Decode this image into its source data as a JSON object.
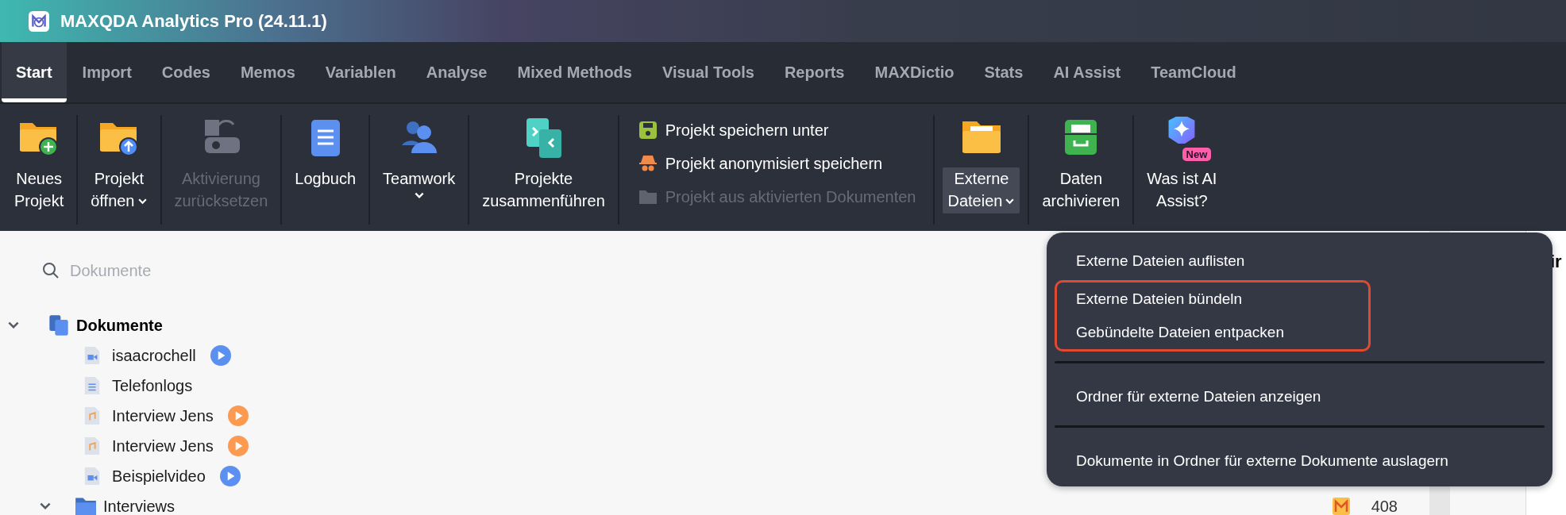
{
  "window": {
    "title": "MAXQDA Analytics Pro (24.11.1)"
  },
  "tabs": [
    {
      "label": "Start",
      "selected": true
    },
    {
      "label": "Import",
      "selected": false
    },
    {
      "label": "Codes",
      "selected": false
    },
    {
      "label": "Memos",
      "selected": false
    },
    {
      "label": "Variablen",
      "selected": false
    },
    {
      "label": "Analyse",
      "selected": false
    },
    {
      "label": "Mixed Methods",
      "selected": false
    },
    {
      "label": "Visual Tools",
      "selected": false
    },
    {
      "label": "Reports",
      "selected": false
    },
    {
      "label": "MAXDictio",
      "selected": false
    },
    {
      "label": "Stats",
      "selected": false
    },
    {
      "label": "AI Assist",
      "selected": false
    },
    {
      "label": "TeamCloud",
      "selected": false
    }
  ],
  "toolbar": [
    {
      "kind": "large",
      "lines": [
        "Neues",
        "Projekt"
      ],
      "dropdown": false,
      "disabled": false,
      "open": false
    },
    {
      "kind": "large",
      "lines": [
        "Projekt",
        "öffnen"
      ],
      "dropdown": true,
      "disabled": false,
      "open": false
    },
    {
      "kind": "large",
      "lines": [
        "Aktivierung",
        "zurücksetzen"
      ],
      "dropdown": false,
      "disabled": true,
      "open": false
    },
    {
      "kind": "large",
      "lines": [
        "Logbuch"
      ],
      "dropdown": false,
      "disabled": false,
      "open": false
    },
    {
      "kind": "large",
      "lines": [
        "Teamwork"
      ],
      "dropdown": true,
      "disabled": false,
      "open": false
    },
    {
      "kind": "large",
      "lines": [
        "Projekte",
        "zusammenführen"
      ],
      "dropdown": false,
      "disabled": false,
      "open": false
    },
    {
      "kind": "stack",
      "items": [
        {
          "label": "Projekt speichern unter",
          "disabled": false
        },
        {
          "label": "Projekt anonymisiert speichern",
          "disabled": false
        },
        {
          "label": "Projekt aus aktivierten Dokumenten",
          "disabled": true
        }
      ]
    },
    {
      "kind": "large",
      "lines": [
        "Externe",
        "Dateien"
      ],
      "dropdown": true,
      "disabled": false,
      "open": true
    },
    {
      "kind": "large",
      "lines": [
        "Daten",
        "archivieren"
      ],
      "dropdown": false,
      "disabled": false,
      "open": false
    },
    {
      "kind": "large",
      "lines": [
        "Was ist AI",
        "Assist?"
      ],
      "dropdown": false,
      "disabled": false,
      "open": false,
      "badge": "New"
    }
  ],
  "search": {
    "placeholder": "Dokumente"
  },
  "tree": [
    {
      "kind": "root",
      "label": "Dokumente",
      "expanded": true,
      "children": [
        {
          "kind": "video",
          "label": "isaacrochell"
        },
        {
          "kind": "text",
          "label": "Telefonlogs"
        },
        {
          "kind": "audio",
          "label": "Interview Jens"
        },
        {
          "kind": "audio",
          "label": "Interview Jens"
        },
        {
          "kind": "video",
          "label": "Beispielvideo"
        }
      ]
    },
    {
      "kind": "folder",
      "label": "Interviews",
      "expanded": true,
      "count": "408"
    }
  ],
  "right_panel": {
    "heading": "ir"
  },
  "menu": {
    "sections": [
      {
        "groups": [
          {
            "highlighted": false,
            "items": [
              "Externe Dateien auflisten"
            ]
          },
          {
            "highlighted": true,
            "items": [
              "Externe Dateien bündeln",
              "Gebündelte Dateien entpacken"
            ]
          }
        ]
      },
      {
        "groups": [
          {
            "highlighted": false,
            "items": [
              "Ordner für externe Dateien anzeigen"
            ]
          }
        ]
      },
      {
        "groups": [
          {
            "highlighted": false,
            "items": [
              "Dokumente in Ordner für externe Dokumente auslagern"
            ]
          }
        ]
      }
    ]
  }
}
